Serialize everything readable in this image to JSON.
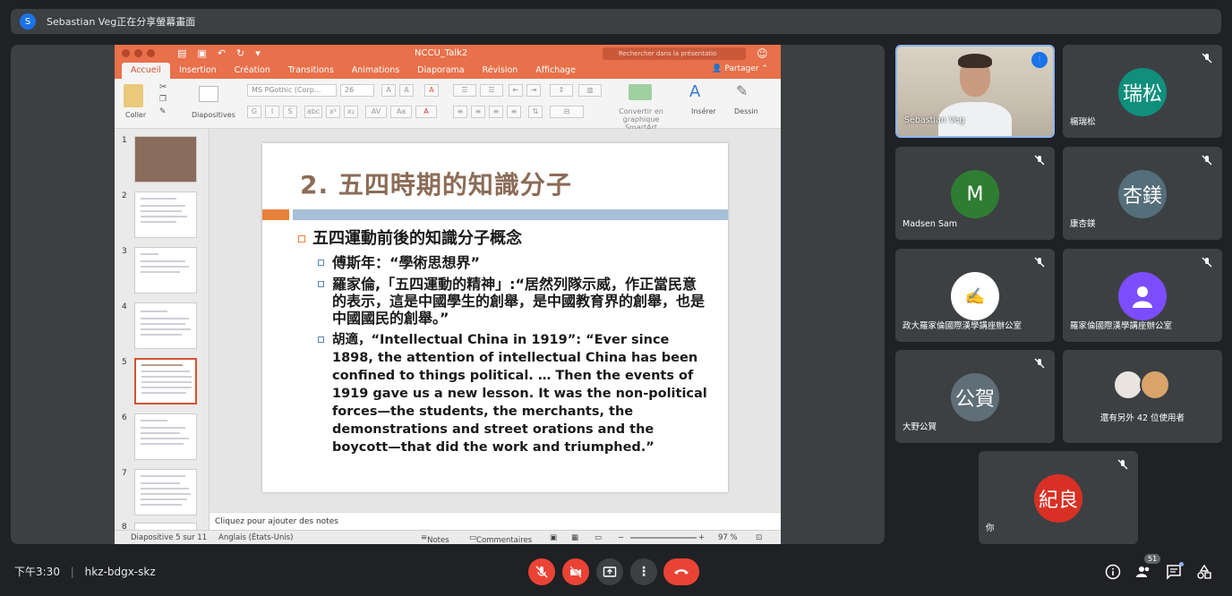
{
  "banner": {
    "avatar_letter": "S",
    "text": "Sebastian Veg正在分享螢幕畫面"
  },
  "ppt": {
    "filename": "NCCU_Talk2",
    "search_placeholder": "Rechercher dans la présentatio",
    "tabs": [
      "Accueil",
      "Insertion",
      "Création",
      "Transitions",
      "Animations",
      "Diaporama",
      "Révision",
      "Affichage"
    ],
    "share_label": "Partager",
    "ribbon": {
      "paste": "Coller",
      "layouts": "Diapositives",
      "font": "MS PGothic (Corp...",
      "size": "26",
      "smartart": "Convertir en graphique SmartArt",
      "insert": "Insérer",
      "draw": "Dessin"
    },
    "thumb_numbers": [
      "1",
      "2",
      "3",
      "4",
      "5",
      "6",
      "7",
      "8"
    ],
    "slide": {
      "title": "2. 五四時期的知識分子",
      "heading": "五四運動前後的知識分子概念",
      "bullet1": "傅斯年：“學術思想界”",
      "bullet2": "羅家倫,「五四運動的精神」:“居然列隊示威，作正當民意的表示，這是中國學生的創舉，是中國教育界的創舉，也是中國國民的創舉。”",
      "bullet3": "胡適，“Intellectual China in 1919”: “Ever since 1898, the attention of intellectual China has been confined to things political. … Then the events of 1919 gave us a new lesson. It was the non-political forces—the students, the merchants, the demonstrations and street orations and the boycott—that did the work and triumphed.”"
    },
    "notes_placeholder": "Cliquez pour ajouter des notes",
    "status": {
      "slide_counter": "Diapositive 5 sur 11",
      "language": "Anglais (États-Unis)",
      "notes": "Notes",
      "comments": "Commentaires",
      "zoom": "97 %"
    }
  },
  "participants": [
    {
      "name": "Sebastian Veg",
      "type": "video"
    },
    {
      "name": "楊瑞松",
      "initials": "瑞松",
      "color": "#0f8f7c"
    },
    {
      "name": "Madsen Sam",
      "initials": "M",
      "color": "#2e7d32"
    },
    {
      "name": "康杏鎂",
      "initials": "杏鎂",
      "color": "#546e7a"
    },
    {
      "name": "政大羅家倫國際漢學講座辦公室",
      "initials": "",
      "color": "#ffffff"
    },
    {
      "name": "羅家倫國際漢學講座辦公室",
      "initials": "",
      "color": "#7c4dff"
    },
    {
      "name": "大野公賀",
      "initials": "公賀",
      "color": "#5f6e77"
    },
    {
      "name": "還有另外 42 位使用者",
      "initials": "",
      "color": ""
    },
    {
      "name": "你",
      "initials": "紀良",
      "color": "#d93025"
    }
  ],
  "bottom": {
    "time": "下午3:30",
    "meeting_code": "hkz-bdgx-skz",
    "people_count": "51"
  },
  "colors": {
    "accent": "#e8704a",
    "end_call": "#ea4335"
  }
}
